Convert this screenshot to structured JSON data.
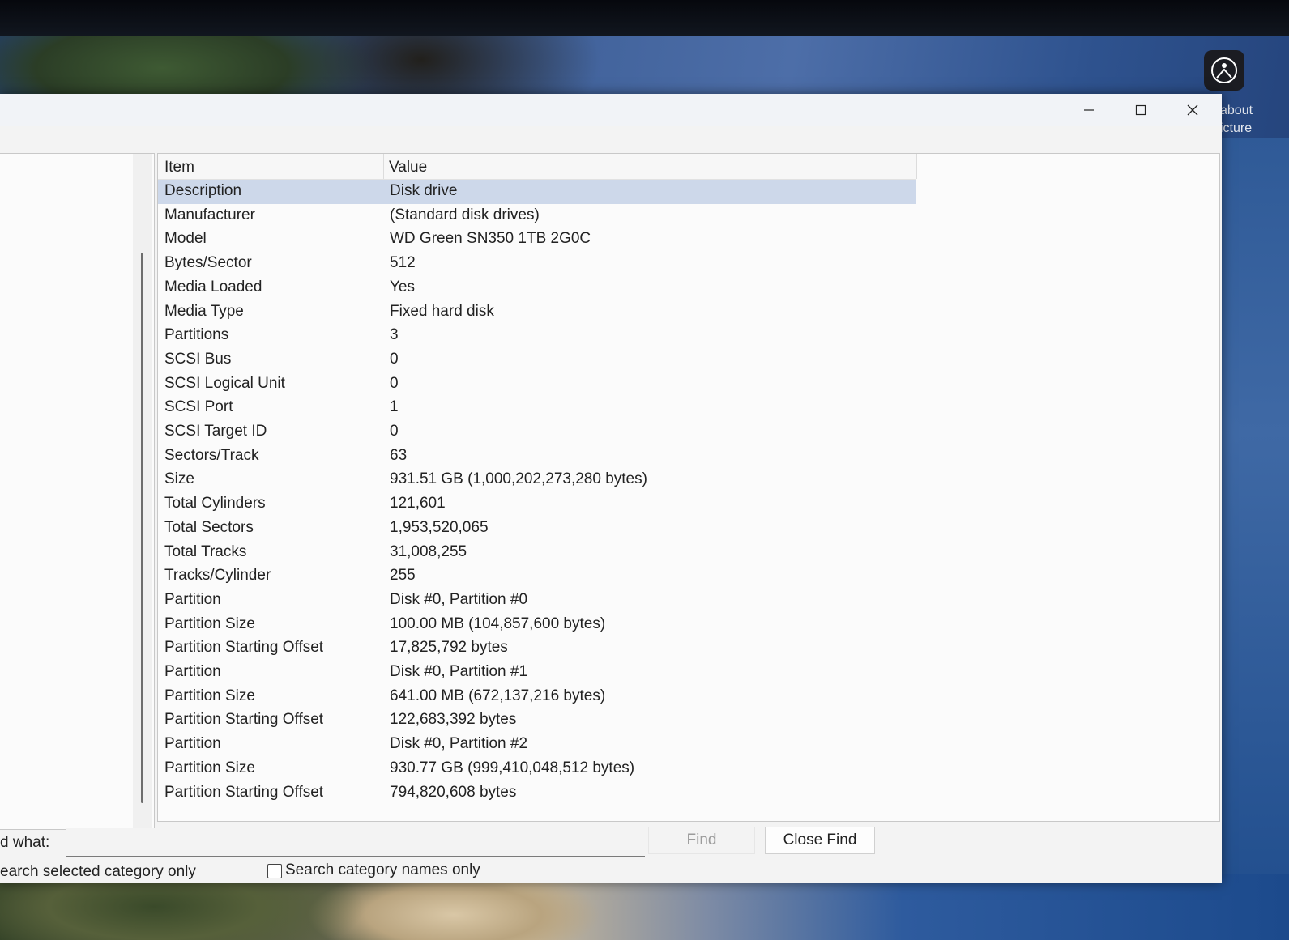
{
  "desktop": {
    "picture_label_line1": "about",
    "picture_label_line2": "icture"
  },
  "window": {
    "controls": {
      "minimize": "—",
      "maximize": "☐",
      "close": "✕"
    }
  },
  "list": {
    "columns": {
      "item": "Item",
      "value": "Value"
    },
    "rows": [
      {
        "item": "Description",
        "value": "Disk drive"
      },
      {
        "item": "Manufacturer",
        "value": "(Standard disk drives)"
      },
      {
        "item": "Model",
        "value": "WD Green SN350 1TB 2G0C"
      },
      {
        "item": "Bytes/Sector",
        "value": "512"
      },
      {
        "item": "Media Loaded",
        "value": "Yes"
      },
      {
        "item": "Media Type",
        "value": "Fixed hard disk"
      },
      {
        "item": "Partitions",
        "value": "3"
      },
      {
        "item": "SCSI Bus",
        "value": "0"
      },
      {
        "item": "SCSI Logical Unit",
        "value": "0"
      },
      {
        "item": "SCSI Port",
        "value": "1"
      },
      {
        "item": "SCSI Target ID",
        "value": "0"
      },
      {
        "item": "Sectors/Track",
        "value": "63"
      },
      {
        "item": "Size",
        "value": "931.51 GB (1,000,202,273,280 bytes)"
      },
      {
        "item": "Total Cylinders",
        "value": "121,601"
      },
      {
        "item": "Total Sectors",
        "value": "1,953,520,065"
      },
      {
        "item": "Total Tracks",
        "value": "31,008,255"
      },
      {
        "item": "Tracks/Cylinder",
        "value": "255"
      },
      {
        "item": "Partition",
        "value": "Disk #0, Partition #0"
      },
      {
        "item": "Partition Size",
        "value": "100.00 MB (104,857,600 bytes)"
      },
      {
        "item": "Partition Starting Offset",
        "value": "17,825,792 bytes"
      },
      {
        "item": "Partition",
        "value": "Disk #0, Partition #1"
      },
      {
        "item": "Partition Size",
        "value": "641.00 MB (672,137,216 bytes)"
      },
      {
        "item": "Partition Starting Offset",
        "value": "122,683,392 bytes"
      },
      {
        "item": "Partition",
        "value": "Disk #0, Partition #2"
      },
      {
        "item": "Partition Size",
        "value": "930.77 GB (999,410,048,512 bytes)"
      },
      {
        "item": "Partition Starting Offset",
        "value": "794,820,608 bytes"
      }
    ]
  },
  "find": {
    "label": "d what:",
    "input_value": "",
    "find_button": "Find",
    "close_find_button": "Close Find",
    "option_selected_category": "earch selected category only",
    "option_category_names": "Search category names only"
  }
}
